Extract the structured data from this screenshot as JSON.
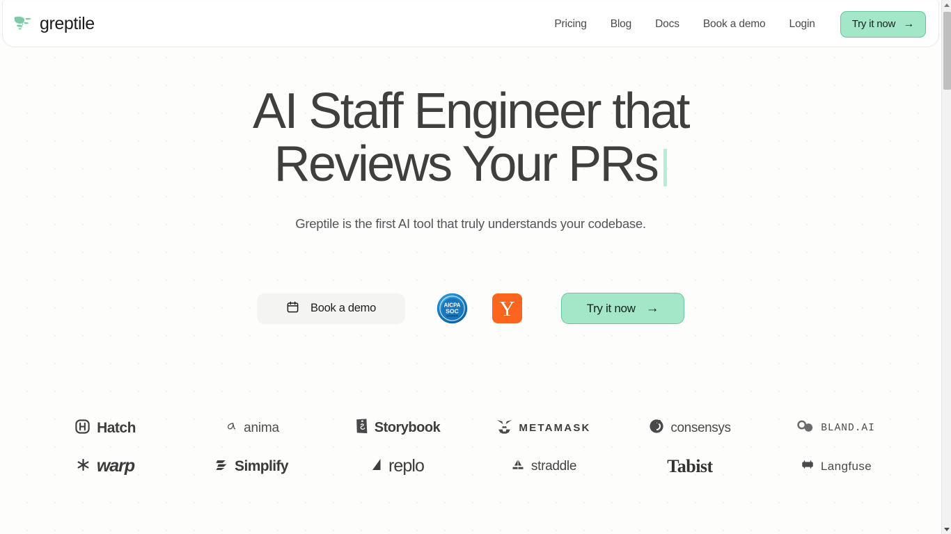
{
  "brand": {
    "name": "greptile",
    "logo_icon": "greptile-leaf-mark",
    "logo_color": "#7fc9a6"
  },
  "nav": {
    "links": [
      {
        "label": "Pricing"
      },
      {
        "label": "Blog"
      },
      {
        "label": "Docs"
      },
      {
        "label": "Book a demo"
      },
      {
        "label": "Login"
      }
    ],
    "cta": {
      "label": "Try it now",
      "arrow": "→",
      "bg_color": "#a3e7c8",
      "border_color": "#5fc79a"
    }
  },
  "hero": {
    "title": "AI Staff Engineer that\nReviews Your PRs",
    "caret_color": "#b9ecd6",
    "subtitle": "Greptile is the first AI tool that truly understands your codebase.",
    "cta": {
      "book_demo": {
        "label": "Book a demo",
        "icon": "calendar-icon",
        "bg_color": "#f4f4f2"
      },
      "try_now": {
        "label": "Try it now",
        "arrow": "→",
        "bg_color": "#a3e7c8",
        "border_color": "#63c89c"
      }
    },
    "badges": [
      {
        "name": "aicpa-soc-badge",
        "line1": "AICPA",
        "line2": "SOC",
        "color": "#1a7fc4"
      },
      {
        "name": "y-combinator-badge",
        "letter": "Y",
        "color": "#fb651e"
      }
    ]
  },
  "logo_wall": {
    "rows": [
      [
        {
          "name": "hatch",
          "label": "Hatch",
          "icon": "hatch-icon"
        },
        {
          "name": "anima",
          "label": "anima",
          "icon": "anima-alpha-icon"
        },
        {
          "name": "storybook",
          "label": "Storybook",
          "icon": "storybook-icon"
        },
        {
          "name": "metamask",
          "label": "METAMASK",
          "icon": "metamask-fox-icon"
        },
        {
          "name": "consensys",
          "label": "consensys",
          "icon": "consensys-icon"
        },
        {
          "name": "bland-ai",
          "label": "BLAND.AI",
          "icon": "bland-infinity-icon"
        }
      ],
      [
        {
          "name": "warp",
          "label": "warp",
          "icon": "warp-asterisk-icon"
        },
        {
          "name": "simplify",
          "label": "Simplify",
          "icon": "simplify-icon"
        },
        {
          "name": "replo",
          "label": "replo",
          "icon": "replo-icon"
        },
        {
          "name": "straddle",
          "label": "straddle",
          "icon": "straddle-icon"
        },
        {
          "name": "tabist",
          "label": "Tabist",
          "icon": ""
        },
        {
          "name": "langfuse",
          "label": "Langfuse",
          "icon": "langfuse-icon"
        }
      ]
    ]
  },
  "scrollbar": {
    "up_arrow": "▲",
    "down_arrow": "▼"
  }
}
